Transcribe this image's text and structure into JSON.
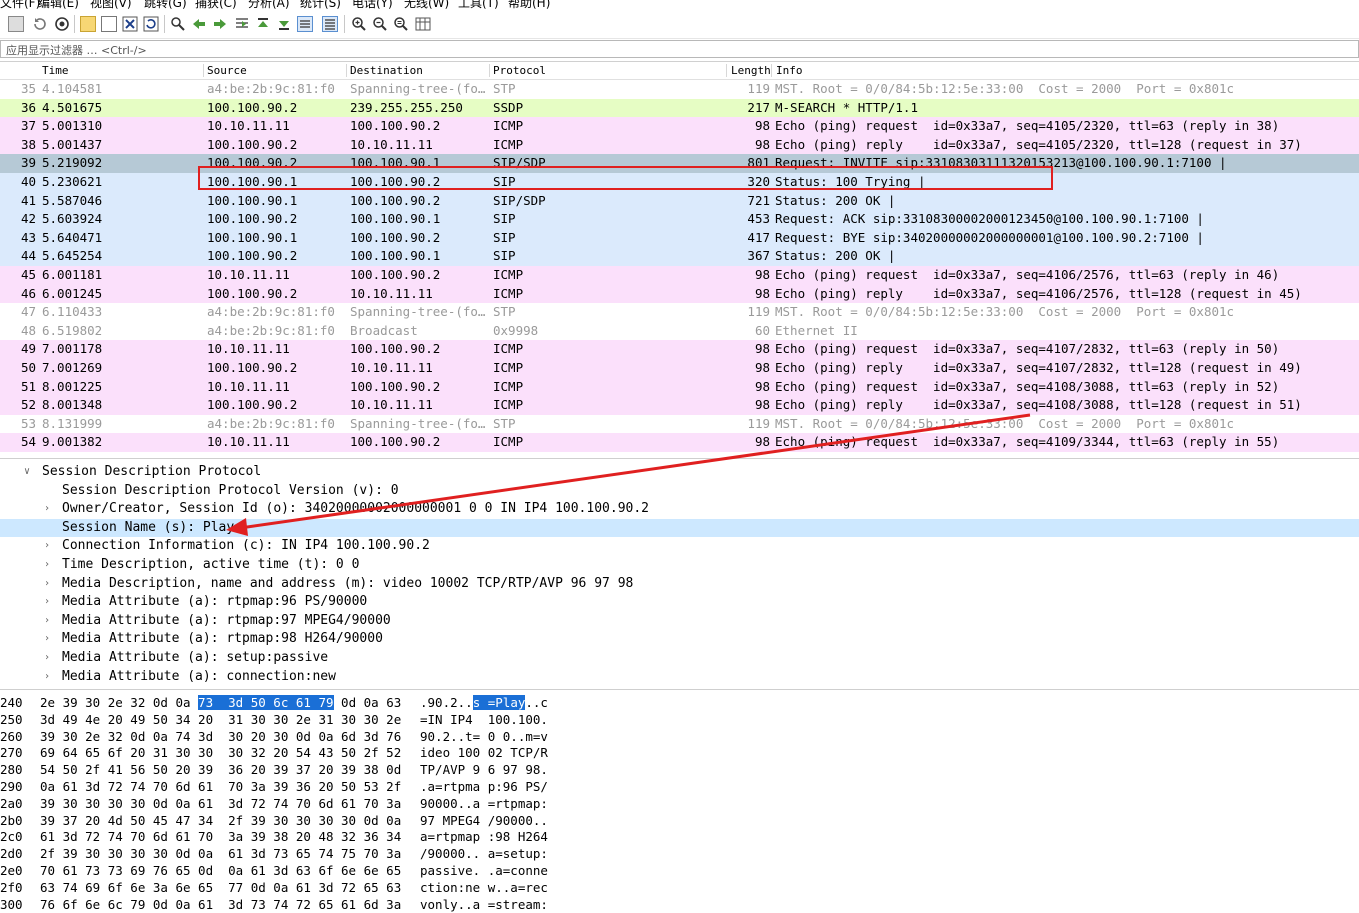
{
  "menu": [
    "文件(F)",
    "编辑(E)",
    "视图(V)",
    "跳转(G)",
    "捕获(C)",
    "分析(A)",
    "统计(S)",
    "电话(Y)",
    "无线(W)",
    "工具(T)",
    "帮助(H)"
  ],
  "filter": {
    "placeholder": "应用显示过滤器 … <Ctrl-/>"
  },
  "columns": {
    "time": "Time",
    "source": "Source",
    "destination": "Destination",
    "protocol": "Protocol",
    "length": "Length",
    "info": "Info"
  },
  "colors": {
    "stp_bg": "#ffffff",
    "stp_fg": "#9a9a9a",
    "ssdp_bg": "#e6fdc4",
    "icmp_bg": "#fbe0fb",
    "sip_bg": "#dbeafc",
    "selected_bg": "#b6c9d6",
    "highlight": "#1a6fd6",
    "annotation_red": "#e02020"
  },
  "packets": [
    {
      "no": "35",
      "time": "4.104581",
      "src": "a4:be:2b:9c:81:f0",
      "dst": "Spanning-tree-(fo…",
      "proto": "STP",
      "len": "119",
      "info": "MST. Root = 0/0/84:5b:12:5e:33:00  Cost = 2000  Port = 0x801c",
      "kind": "stp"
    },
    {
      "no": "36",
      "time": "4.501675",
      "src": "100.100.90.2",
      "dst": "239.255.255.250",
      "proto": "SSDP",
      "len": "217",
      "info": "M-SEARCH * HTTP/1.1",
      "kind": "ssdp"
    },
    {
      "no": "37",
      "time": "5.001310",
      "src": "10.10.11.11",
      "dst": "100.100.90.2",
      "proto": "ICMP",
      "len": "98",
      "info": "Echo (ping) request  id=0x33a7, seq=4105/2320, ttl=63 (reply in 38)",
      "kind": "icmp"
    },
    {
      "no": "38",
      "time": "5.001437",
      "src": "100.100.90.2",
      "dst": "10.10.11.11",
      "proto": "ICMP",
      "len": "98",
      "info": "Echo (ping) reply    id=0x33a7, seq=4105/2320, ttl=128 (request in 37)",
      "kind": "icmp"
    },
    {
      "no": "39",
      "time": "5.219092",
      "src": "100.100.90.2",
      "dst": "100.100.90.1",
      "proto": "SIP/SDP",
      "len": "801",
      "info": "Request: INVITE sip:33108303111320153213@100.100.90.1:7100 |",
      "kind": "selected"
    },
    {
      "no": "40",
      "time": "5.230621",
      "src": "100.100.90.1",
      "dst": "100.100.90.2",
      "proto": "SIP",
      "len": "320",
      "info": "Status: 100 Trying |",
      "kind": "sip"
    },
    {
      "no": "41",
      "time": "5.587046",
      "src": "100.100.90.1",
      "dst": "100.100.90.2",
      "proto": "SIP/SDP",
      "len": "721",
      "info": "Status: 200 OK |",
      "kind": "sip"
    },
    {
      "no": "42",
      "time": "5.603924",
      "src": "100.100.90.2",
      "dst": "100.100.90.1",
      "proto": "SIP",
      "len": "453",
      "info": "Request: ACK sip:33108300002000123450@100.100.90.1:7100 |",
      "kind": "sip"
    },
    {
      "no": "43",
      "time": "5.640471",
      "src": "100.100.90.1",
      "dst": "100.100.90.2",
      "proto": "SIP",
      "len": "417",
      "info": "Request: BYE sip:34020000002000000001@100.100.90.2:7100 |",
      "kind": "sip"
    },
    {
      "no": "44",
      "time": "5.645254",
      "src": "100.100.90.2",
      "dst": "100.100.90.1",
      "proto": "SIP",
      "len": "367",
      "info": "Status: 200 OK |",
      "kind": "sip"
    },
    {
      "no": "45",
      "time": "6.001181",
      "src": "10.10.11.11",
      "dst": "100.100.90.2",
      "proto": "ICMP",
      "len": "98",
      "info": "Echo (ping) request  id=0x33a7, seq=4106/2576, ttl=63 (reply in 46)",
      "kind": "icmp"
    },
    {
      "no": "46",
      "time": "6.001245",
      "src": "100.100.90.2",
      "dst": "10.10.11.11",
      "proto": "ICMP",
      "len": "98",
      "info": "Echo (ping) reply    id=0x33a7, seq=4106/2576, ttl=128 (request in 45)",
      "kind": "icmp"
    },
    {
      "no": "47",
      "time": "6.110433",
      "src": "a4:be:2b:9c:81:f0",
      "dst": "Spanning-tree-(fo…",
      "proto": "STP",
      "len": "119",
      "info": "MST. Root = 0/0/84:5b:12:5e:33:00  Cost = 2000  Port = 0x801c",
      "kind": "stp"
    },
    {
      "no": "48",
      "time": "6.519802",
      "src": "a4:be:2b:9c:81:f0",
      "dst": "Broadcast",
      "proto": "0x9998",
      "len": "60",
      "info": "Ethernet II",
      "kind": "stp"
    },
    {
      "no": "49",
      "time": "7.001178",
      "src": "10.10.11.11",
      "dst": "100.100.90.2",
      "proto": "ICMP",
      "len": "98",
      "info": "Echo (ping) request  id=0x33a7, seq=4107/2832, ttl=63 (reply in 50)",
      "kind": "icmp"
    },
    {
      "no": "50",
      "time": "7.001269",
      "src": "100.100.90.2",
      "dst": "10.10.11.11",
      "proto": "ICMP",
      "len": "98",
      "info": "Echo (ping) reply    id=0x33a7, seq=4107/2832, ttl=128 (request in 49)",
      "kind": "icmp"
    },
    {
      "no": "51",
      "time": "8.001225",
      "src": "10.10.11.11",
      "dst": "100.100.90.2",
      "proto": "ICMP",
      "len": "98",
      "info": "Echo (ping) request  id=0x33a7, seq=4108/3088, ttl=63 (reply in 52)",
      "kind": "icmp"
    },
    {
      "no": "52",
      "time": "8.001348",
      "src": "100.100.90.2",
      "dst": "10.10.11.11",
      "proto": "ICMP",
      "len": "98",
      "info": "Echo (ping) reply    id=0x33a7, seq=4108/3088, ttl=128 (request in 51)",
      "kind": "icmp"
    },
    {
      "no": "53",
      "time": "8.131999",
      "src": "a4:be:2b:9c:81:f0",
      "dst": "Spanning-tree-(fo…",
      "proto": "STP",
      "len": "119",
      "info": "MST. Root = 0/0/84:5b:12:5e:33:00  Cost = 2000  Port = 0x801c",
      "kind": "stp"
    },
    {
      "no": "54",
      "time": "9.001382",
      "src": "10.10.11.11",
      "dst": "100.100.90.2",
      "proto": "ICMP",
      "len": "98",
      "info": "Echo (ping) request  id=0x33a7, seq=4109/3344, ttl=63 (reply in 55)",
      "kind": "icmp"
    }
  ],
  "details": [
    {
      "text": "Session Description Protocol",
      "indent": 0,
      "expander": "open",
      "highlight": false
    },
    {
      "text": "Session Description Protocol Version (v): 0",
      "indent": 1,
      "expander": "none",
      "highlight": false
    },
    {
      "text": "Owner/Creator, Session Id (o): 34020000002000000001 0 0 IN IP4 100.100.90.2",
      "indent": 1,
      "expander": "closed",
      "highlight": false
    },
    {
      "text": "Session Name (s): Play",
      "indent": 1,
      "expander": "none",
      "highlight": true
    },
    {
      "text": "Connection Information (c): IN IP4 100.100.90.2",
      "indent": 1,
      "expander": "closed",
      "highlight": false
    },
    {
      "text": "Time Description, active time (t): 0 0",
      "indent": 1,
      "expander": "closed",
      "highlight": false
    },
    {
      "text": "Media Description, name and address (m): video 10002 TCP/RTP/AVP 96 97 98",
      "indent": 1,
      "expander": "closed",
      "highlight": false
    },
    {
      "text": "Media Attribute (a): rtpmap:96 PS/90000",
      "indent": 1,
      "expander": "closed",
      "highlight": false
    },
    {
      "text": "Media Attribute (a): rtpmap:97 MPEG4/90000",
      "indent": 1,
      "expander": "closed",
      "highlight": false
    },
    {
      "text": "Media Attribute (a): rtpmap:98 H264/90000",
      "indent": 1,
      "expander": "closed",
      "highlight": false
    },
    {
      "text": "Media Attribute (a): setup:passive",
      "indent": 1,
      "expander": "closed",
      "highlight": false
    },
    {
      "text": "Media Attribute (a): connection:new",
      "indent": 1,
      "expander": "closed",
      "highlight": false
    }
  ],
  "hex": [
    {
      "off": "240",
      "pre": "2e 39 30 2e 32 0d 0a ",
      "hl": "73  3d 50 6c 61 79",
      "post": " 0d 0a 63",
      "apre": ".90.2..",
      "ahl": "s =Play",
      "apost": "..c"
    },
    {
      "off": "250",
      "pre": "3d 49 4e 20 49 50 34 20  31 30 30 2e 31 30 30 2e",
      "hl": "",
      "post": "",
      "apre": "=IN IP4  100.100.",
      "ahl": "",
      "apost": ""
    },
    {
      "off": "260",
      "pre": "39 30 2e 32 0d 0a 74 3d  30 20 30 0d 0a 6d 3d 76",
      "hl": "",
      "post": "",
      "apre": "90.2..t= 0 0..m=v",
      "ahl": "",
      "apost": ""
    },
    {
      "off": "270",
      "pre": "69 64 65 6f 20 31 30 30  30 32 20 54 43 50 2f 52",
      "hl": "",
      "post": "",
      "apre": "ideo 100 02 TCP/R",
      "ahl": "",
      "apost": ""
    },
    {
      "off": "280",
      "pre": "54 50 2f 41 56 50 20 39  36 20 39 37 20 39 38 0d",
      "hl": "",
      "post": "",
      "apre": "TP/AVP 9 6 97 98.",
      "ahl": "",
      "apost": ""
    },
    {
      "off": "290",
      "pre": "0a 61 3d 72 74 70 6d 61  70 3a 39 36 20 50 53 2f",
      "hl": "",
      "post": "",
      "apre": ".a=rtpma p:96 PS/",
      "ahl": "",
      "apost": ""
    },
    {
      "off": "2a0",
      "pre": "39 30 30 30 30 0d 0a 61  3d 72 74 70 6d 61 70 3a",
      "hl": "",
      "post": "",
      "apre": "90000..a =rtpmap:",
      "ahl": "",
      "apost": ""
    },
    {
      "off": "2b0",
      "pre": "39 37 20 4d 50 45 47 34  2f 39 30 30 30 30 0d 0a",
      "hl": "",
      "post": "",
      "apre": "97 MPEG4 /90000..",
      "ahl": "",
      "apost": ""
    },
    {
      "off": "2c0",
      "pre": "61 3d 72 74 70 6d 61 70  3a 39 38 20 48 32 36 34",
      "hl": "",
      "post": "",
      "apre": "a=rtpmap :98 H264",
      "ahl": "",
      "apost": ""
    },
    {
      "off": "2d0",
      "pre": "2f 39 30 30 30 30 0d 0a  61 3d 73 65 74 75 70 3a",
      "hl": "",
      "post": "",
      "apre": "/90000.. a=setup:",
      "ahl": "",
      "apost": ""
    },
    {
      "off": "2e0",
      "pre": "70 61 73 73 69 76 65 0d  0a 61 3d 63 6f 6e 6e 65",
      "hl": "",
      "post": "",
      "apre": "passive. .a=conne",
      "ahl": "",
      "apost": ""
    },
    {
      "off": "2f0",
      "pre": "63 74 69 6f 6e 3a 6e 65  77 0d 0a 61 3d 72 65 63",
      "hl": "",
      "post": "",
      "apre": "ction:ne w..a=rec",
      "ahl": "",
      "apost": ""
    },
    {
      "off": "300",
      "pre": "76 6f 6e 6c 79 0d 0a 61  3d 73 74 72 65 61 6d 3a",
      "hl": "",
      "post": "",
      "apre": "vonly..a =stream:",
      "ahl": "",
      "apost": ""
    }
  ]
}
